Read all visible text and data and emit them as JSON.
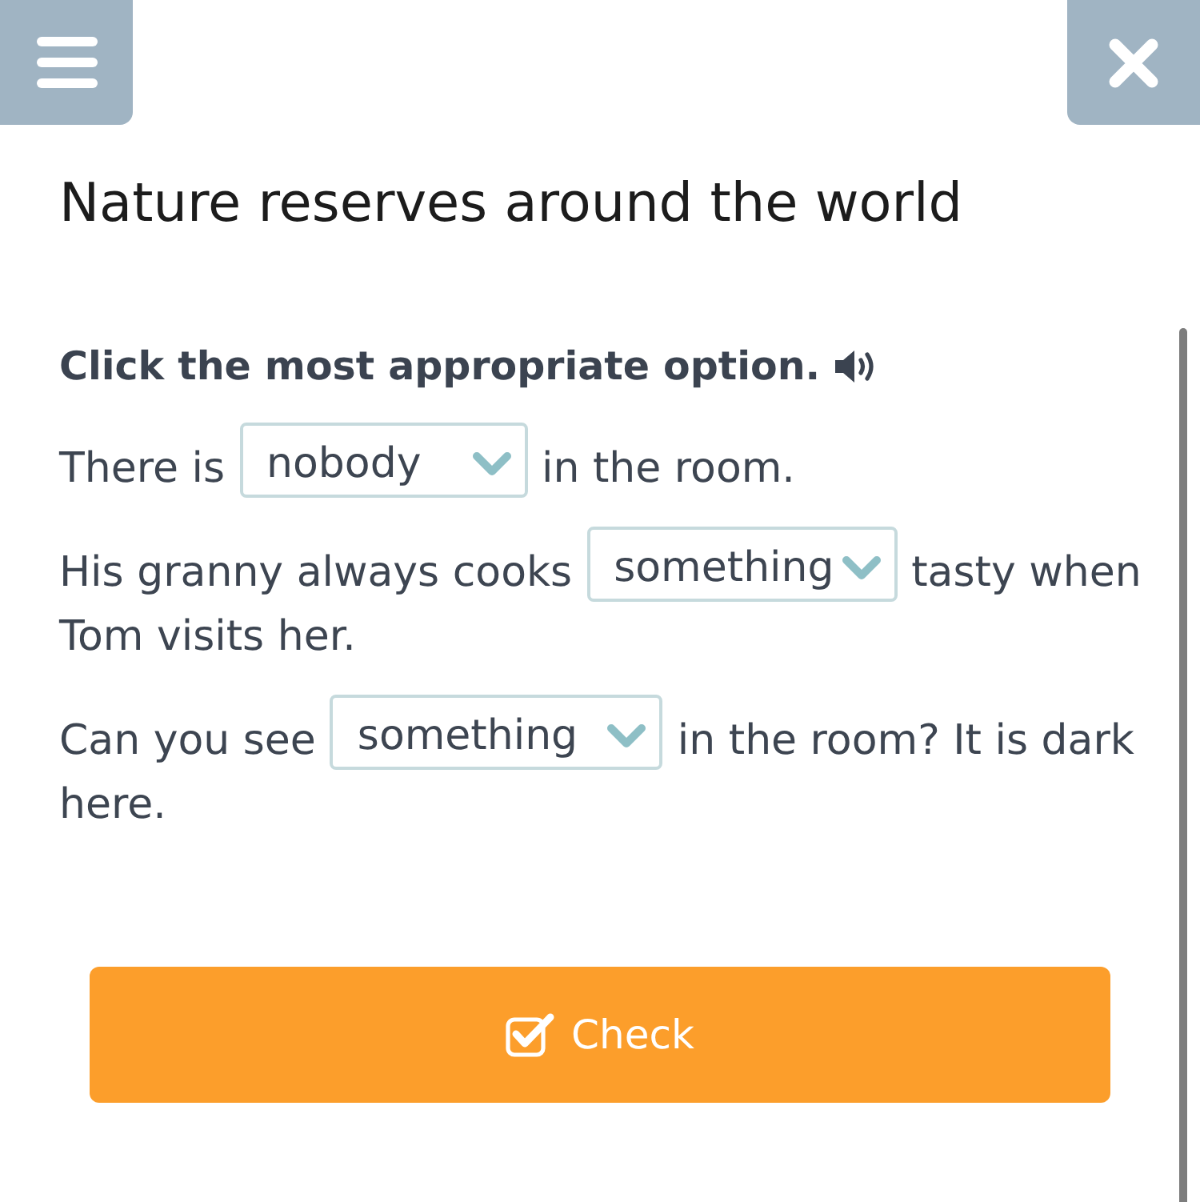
{
  "header": {
    "title": "Nature reserves around the world"
  },
  "exercise": {
    "instruction": "Click the most appropriate option.",
    "sentences": [
      {
        "before": "There is",
        "choice": "nobody",
        "after": [
          "in the room."
        ]
      },
      {
        "before": "His granny always cooks",
        "choice": "something",
        "after": [
          "tasty when",
          "Tom visits her."
        ]
      },
      {
        "before": "Can you see",
        "choice": "something",
        "after": [
          "in the room? It is dark",
          "here."
        ]
      }
    ]
  },
  "check_button": {
    "label": "Check"
  }
}
